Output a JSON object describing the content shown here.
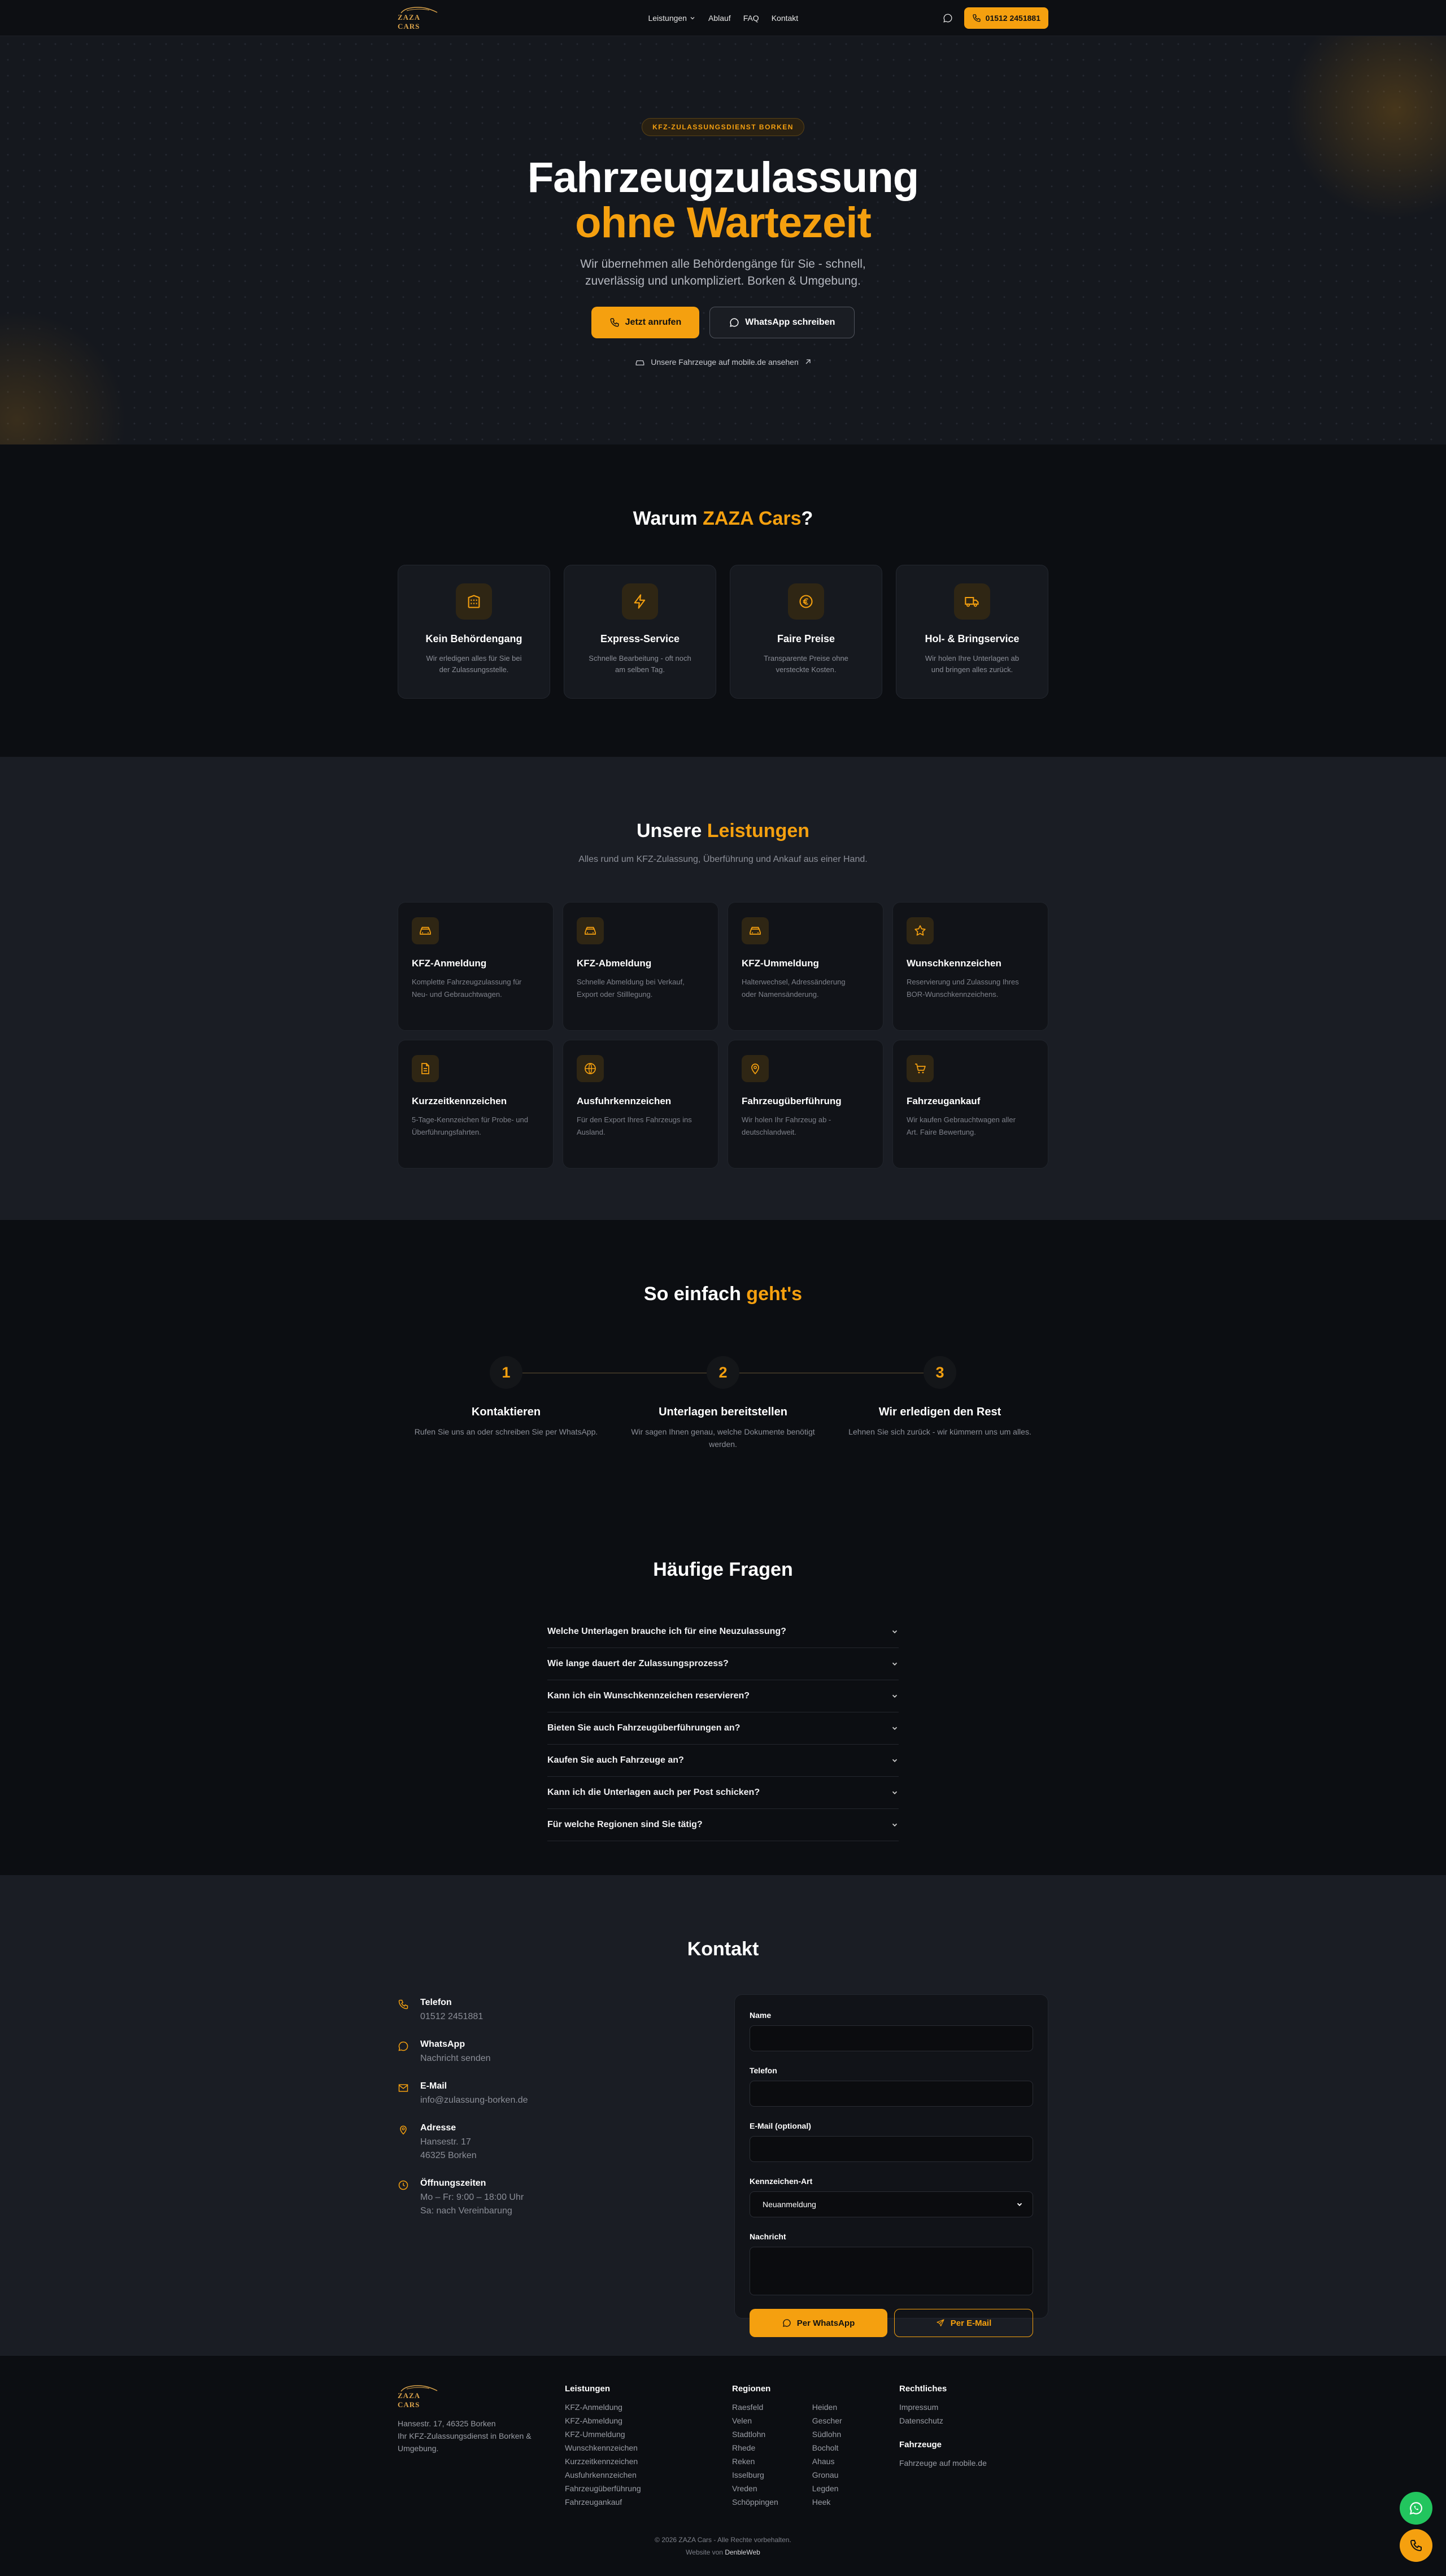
{
  "brand": {
    "logo_text": "ZAZA CARS",
    "accent": "#f5a00f",
    "whatsapp_green": "#22c55e"
  },
  "nav": {
    "items": [
      "Leistungen",
      "Ablauf",
      "FAQ",
      "Kontakt"
    ],
    "phone": "01512 2451881"
  },
  "hero": {
    "badge": "KFZ-ZULASSUNGSDIENST BORKEN",
    "title_line1": "Fahrzeugzulassung",
    "title_line2": "ohne Wartezeit",
    "subtitle": "Wir übernehmen alle Behördengänge für Sie - schnell, zuverlässig und unkompliziert. Borken & Umgebung.",
    "cta_call": "Jetzt anrufen",
    "cta_whatsapp": "WhatsApp schreiben",
    "mobile_link": "Unsere Fahrzeuge auf mobile.de ansehen"
  },
  "why": {
    "title_pre": "Warum ",
    "title_accent": "ZAZA Cars",
    "title_post": "?",
    "cards": [
      {
        "icon": "building-icon",
        "title": "Kein Behördengang",
        "text": "Wir erledigen alles für Sie bei der Zulassungsstelle."
      },
      {
        "icon": "lightning-icon",
        "title": "Express-Service",
        "text": "Schnelle Bearbeitung - oft noch am selben Tag."
      },
      {
        "icon": "euro-icon",
        "title": "Faire Preise",
        "text": "Transparente Preise ohne versteckte Kosten."
      },
      {
        "icon": "truck-icon",
        "title": "Hol- & Bringservice",
        "text": "Wir holen Ihre Unterlagen ab und bringen alles zurück."
      }
    ]
  },
  "services": {
    "title_pre": "Unsere ",
    "title_accent": "Leistungen",
    "subtitle": "Alles rund um KFZ-Zulassung, Überführung und Ankauf aus einer Hand.",
    "cards": [
      {
        "icon": "car-icon",
        "title": "KFZ-Anmeldung",
        "text": "Komplette Fahrzeugzulassung für Neu- und Gebrauchtwagen."
      },
      {
        "icon": "car-icon",
        "title": "KFZ-Abmeldung",
        "text": "Schnelle Abmeldung bei Verkauf, Export oder Stilllegung."
      },
      {
        "icon": "car-icon",
        "title": "KFZ-Ummeldung",
        "text": "Halterwechsel, Adressänderung oder Namensänderung."
      },
      {
        "icon": "star-icon",
        "title": "Wunschkennzeichen",
        "text": "Reservierung und Zulassung Ihres BOR-Wunschkennzeichens."
      },
      {
        "icon": "document-icon",
        "title": "Kurzzeitkennzeichen",
        "text": "5-Tage-Kennzeichen für Probe- und Überführungsfahrten."
      },
      {
        "icon": "globe-icon",
        "title": "Ausfuhrkennzeichen",
        "text": "Für den Export Ihres Fahrzeugs ins Ausland."
      },
      {
        "icon": "pin-icon",
        "title": "Fahrzeugüberführung",
        "text": "Wir holen Ihr Fahrzeug ab - deutschlandweit."
      },
      {
        "icon": "cart-icon",
        "title": "Fahrzeugankauf",
        "text": "Wir kaufen Gebrauchtwagen aller Art. Faire Bewertung."
      }
    ]
  },
  "steps": {
    "title_pre": "So einfach ",
    "title_accent": "geht's",
    "items": [
      {
        "num": "1",
        "title": "Kontaktieren",
        "text": "Rufen Sie uns an oder schreiben Sie per WhatsApp."
      },
      {
        "num": "2",
        "title": "Unterlagen bereitstellen",
        "text": "Wir sagen Ihnen genau, welche Dokumente benötigt werden."
      },
      {
        "num": "3",
        "title": "Wir erledigen den Rest",
        "text": "Lehnen Sie sich zurück - wir kümmern uns um alles."
      }
    ]
  },
  "faq": {
    "title": "Häufige Fragen",
    "items": [
      "Welche Unterlagen brauche ich für eine Neuzulassung?",
      "Wie lange dauert der Zulassungsprozess?",
      "Kann ich ein Wunschkennzeichen reservieren?",
      "Bieten Sie auch Fahrzeugüberführungen an?",
      "Kaufen Sie auch Fahrzeuge an?",
      "Kann ich die Unterlagen auch per Post schicken?",
      "Für welche Regionen sind Sie tätig?"
    ]
  },
  "contact": {
    "title": "Kontakt",
    "info": [
      {
        "icon": "phone-icon",
        "title": "Telefon",
        "lines": [
          "01512 2451881"
        ]
      },
      {
        "icon": "chat-icon",
        "title": "WhatsApp",
        "lines": [
          "Nachricht senden"
        ]
      },
      {
        "icon": "mail-icon",
        "title": "E-Mail",
        "lines": [
          "info@zulassung-borken.de"
        ]
      },
      {
        "icon": "pin-icon",
        "title": "Adresse",
        "lines": [
          "Hansestr. 17",
          "46325 Borken"
        ]
      },
      {
        "icon": "clock-icon",
        "title": "Öffnungszeiten",
        "lines": [
          "Mo – Fr: 9:00 – 18:00 Uhr",
          "Sa: nach Vereinbarung"
        ]
      }
    ],
    "form": {
      "name_label": "Name",
      "phone_label": "Telefon",
      "email_label": "E-Mail (optional)",
      "plate_label": "Kennzeichen-Art",
      "plate_value": "Neuanmeldung",
      "message_label": "Nachricht",
      "btn_whatsapp": "Per WhatsApp",
      "btn_email": "Per E-Mail"
    }
  },
  "footer": {
    "address": "Hansestr. 17, 46325 Borken",
    "desc": "Ihr KFZ-Zulassungsdienst in Borken & Umgebung.",
    "col_services": "Leistungen",
    "services": [
      "KFZ-Anmeldung",
      "KFZ-Abmeldung",
      "KFZ-Ummeldung",
      "Wunschkennzeichen",
      "Kurzzeitkennzeichen",
      "Ausfuhrkennzeichen",
      "Fahrzeugüberführung",
      "Fahrzeugankauf"
    ],
    "col_regions": "Regionen",
    "regions_a": [
      "Raesfeld",
      "Velen",
      "Stadtlohn",
      "Rhede",
      "Reken",
      "Isselburg",
      "Vreden",
      "Schöppingen"
    ],
    "regions_b": [
      "Heiden",
      "Gescher",
      "Südlohn",
      "Bocholt",
      "Ahaus",
      "Gronau",
      "Legden",
      "Heek"
    ],
    "col_legal": "Rechtliches",
    "legal": [
      "Impressum",
      "Datenschutz"
    ],
    "col_vehicles": "Fahrzeuge",
    "vehicles_link": "Fahrzeuge auf mobile.de",
    "copyright": "© 2026 ZAZA Cars - Alle Rechte vorbehalten.",
    "credit_pre": "Website von ",
    "credit_name": "DenbleWeb"
  }
}
